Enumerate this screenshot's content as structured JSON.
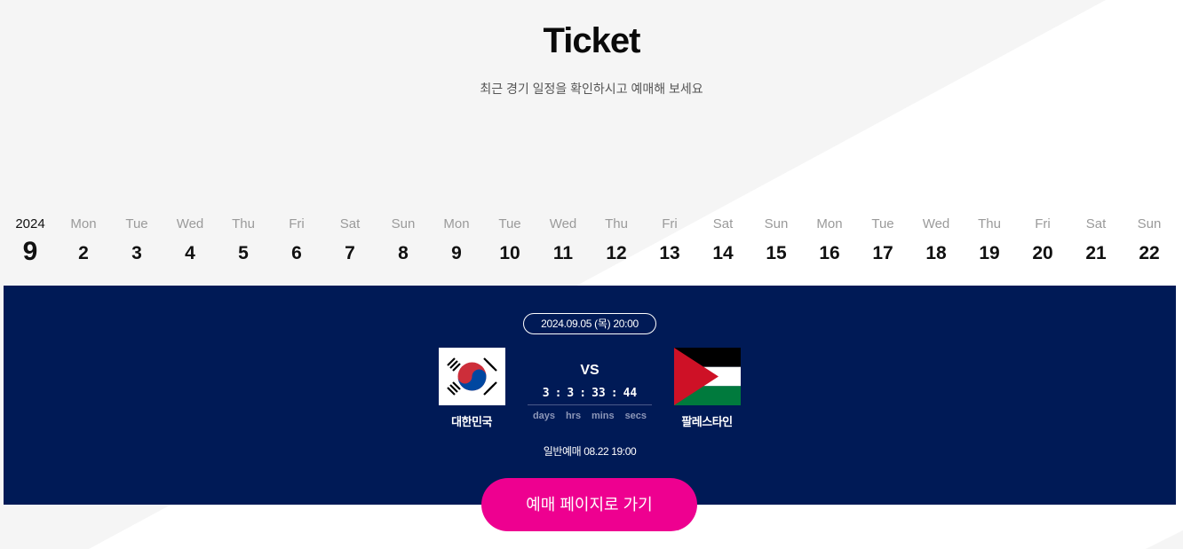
{
  "header": {
    "title": "Ticket",
    "subtitle": "최근 경기 일정을 확인하시고 예매해 보세요"
  },
  "calendar": {
    "year": "2024",
    "month": "9",
    "days": [
      {
        "dow": "Mon",
        "day": "2"
      },
      {
        "dow": "Tue",
        "day": "3"
      },
      {
        "dow": "Wed",
        "day": "4"
      },
      {
        "dow": "Thu",
        "day": "5"
      },
      {
        "dow": "Fri",
        "day": "6"
      },
      {
        "dow": "Sat",
        "day": "7"
      },
      {
        "dow": "Sun",
        "day": "8"
      },
      {
        "dow": "Mon",
        "day": "9"
      },
      {
        "dow": "Tue",
        "day": "10"
      },
      {
        "dow": "Wed",
        "day": "11"
      },
      {
        "dow": "Thu",
        "day": "12"
      },
      {
        "dow": "Fri",
        "day": "13"
      },
      {
        "dow": "Sat",
        "day": "14"
      },
      {
        "dow": "Sun",
        "day": "15"
      },
      {
        "dow": "Mon",
        "day": "16"
      },
      {
        "dow": "Tue",
        "day": "17"
      },
      {
        "dow": "Wed",
        "day": "18"
      },
      {
        "dow": "Thu",
        "day": "19"
      },
      {
        "dow": "Fri",
        "day": "20"
      },
      {
        "dow": "Sat",
        "day": "21"
      },
      {
        "dow": "Sun",
        "day": "22"
      }
    ]
  },
  "match": {
    "datetime": "2024.09.05 (목) 20:00",
    "home_team": "대한민국",
    "home_flag_icon": "south-korea-flag-icon",
    "away_team": "팔레스타인",
    "away_flag_icon": "palestine-flag-icon",
    "vs": "VS",
    "countdown": {
      "days": "3",
      "hrs": "3",
      "mins": "33",
      "secs": "44",
      "sep": ":",
      "labels": {
        "days": "days",
        "hrs": "hrs",
        "mins": "mins",
        "secs": "secs"
      }
    },
    "presale": "일반예매 08.22 19:00"
  },
  "cta": {
    "label": "예매 페이지로 가기"
  },
  "colors": {
    "panel": "#001a56",
    "cta": "#ee0090",
    "bg_light": "#f5f5f5"
  }
}
